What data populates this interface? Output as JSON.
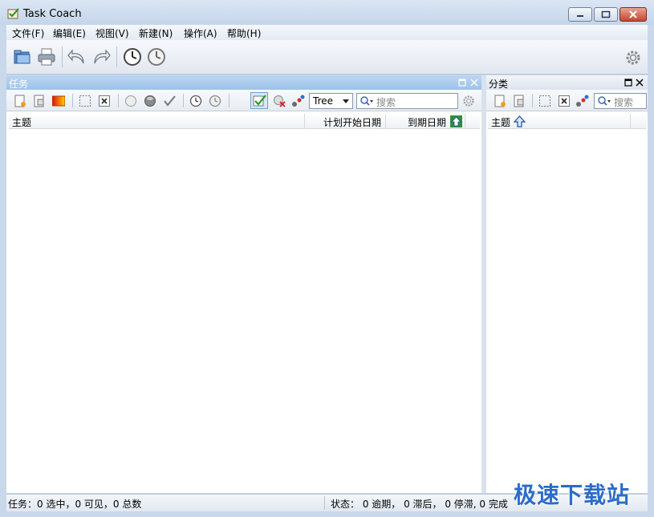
{
  "window": {
    "title": "Task Coach"
  },
  "menu": [
    "文件(F)",
    "编辑(E)",
    "视图(V)",
    "新建(N)",
    "操作(A)",
    "帮助(H)"
  ],
  "tasks_pane": {
    "title": "任务",
    "view_mode": "Tree",
    "search_placeholder": "搜索",
    "columns": {
      "subject": "主题",
      "planned_start": "计划开始日期",
      "due_date": "到期日期"
    }
  },
  "category_pane": {
    "title": "分类",
    "search_placeholder": "搜索",
    "columns": {
      "subject": "主题"
    }
  },
  "status": {
    "left": "任务：0 选中，0 可见，0 总数",
    "right": "状态： 0 逾期， 0 滞后， 0 停滞, 0 完成"
  },
  "watermark": "极速下载站",
  "colors": {
    "pane_header": "#9cc2ea",
    "frame": "#c9d8ea",
    "watermark": "#2c6cc8"
  }
}
